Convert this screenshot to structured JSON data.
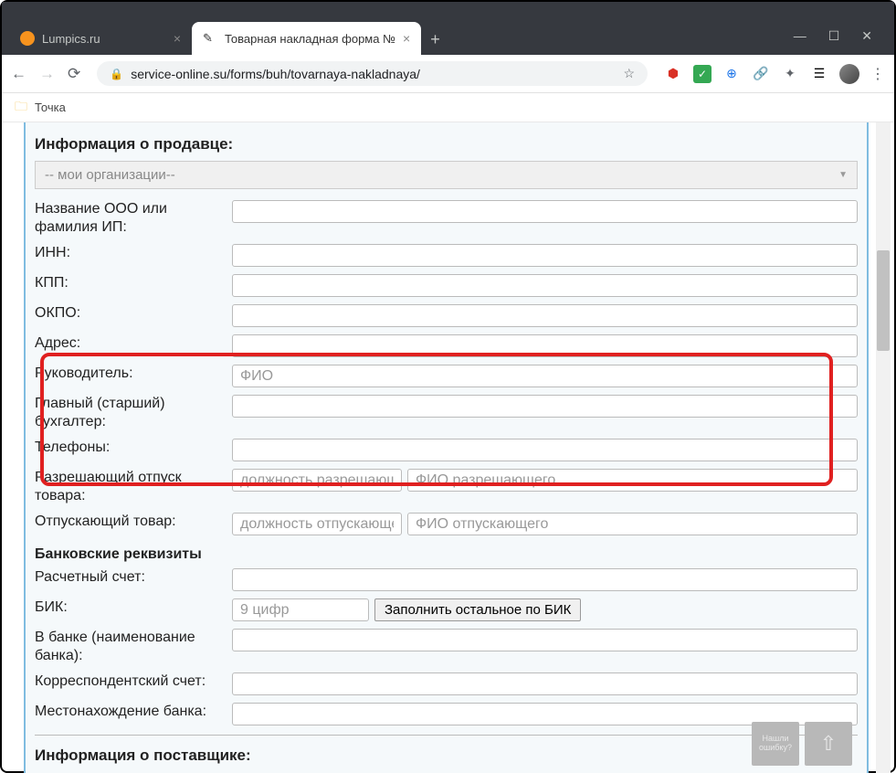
{
  "browser": {
    "tabs": [
      {
        "title": "Lumpics.ru",
        "active": false
      },
      {
        "title": "Товарная накладная форма №",
        "active": true
      }
    ],
    "url": "service-online.su/forms/buh/tovarnaya-nakladnaya/",
    "bookmark": "Точка"
  },
  "seller": {
    "section_title": "Информация о продавце:",
    "dropdown": "-- мои организации--",
    "fields": {
      "name_label": "Название ООО или фамилия ИП:",
      "inn_label": "ИНН:",
      "kpp_label": "КПП:",
      "okpo_label": "ОКПО:",
      "address_label": "Адрес:",
      "director_label": "Руководитель:",
      "director_ph": "ФИО",
      "accountant_label": "Главный (старший) бухгалтер:",
      "phones_label": "Телефоны:",
      "auth_label": "Разрешающий отпуск товара:",
      "auth_pos_ph": "должность разрешающего",
      "auth_fio_ph": "ФИО разрешающего",
      "release_label": "Отпускающий товар:",
      "release_pos_ph": "должность отпускающего",
      "release_fio_ph": "ФИО отпускающего"
    }
  },
  "bank": {
    "section_title": "Банковские реквизиты",
    "account_label": "Расчетный счет:",
    "bik_label": "БИК:",
    "bik_ph": "9 цифр",
    "bik_btn": "Заполнить остальное по БИК",
    "bank_name_label": "В банке (наименование банка):",
    "corr_label": "Корреспондентский счет:",
    "location_label": "Местонахождение банка:"
  },
  "supplier": {
    "section_title": "Информация о поставщике:"
  },
  "footer": {
    "error_btn": "Нашли ошибку?"
  }
}
